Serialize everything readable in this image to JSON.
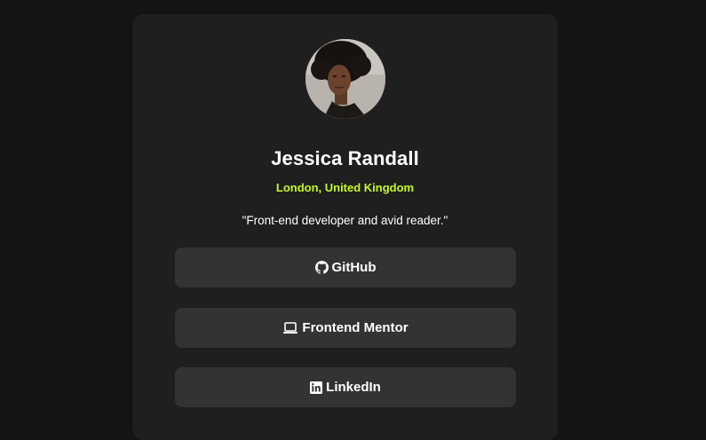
{
  "profile": {
    "name": "Jessica Randall",
    "location": "London, United Kingdom",
    "bio": "\"Front-end developer and avid reader.\""
  },
  "links": [
    {
      "label": "GitHub",
      "icon": "github-icon"
    },
    {
      "label": "Frontend Mentor",
      "icon": "laptop-icon"
    },
    {
      "label": "LinkedIn",
      "icon": "linkedin-icon"
    }
  ],
  "colors": {
    "background": "#141414",
    "card": "#1f1f1f",
    "button": "#333333",
    "accent": "#c4f82a",
    "text": "#ffffff"
  }
}
